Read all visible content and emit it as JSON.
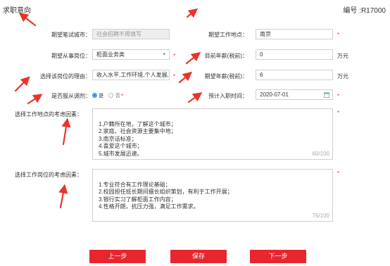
{
  "header": {
    "title": "求职意向",
    "serial_label": "编号 :R17000"
  },
  "form": {
    "interview_city": {
      "label": "期望笔试城市：",
      "placeholder": "社会招聘不用填写",
      "value": ""
    },
    "work_location": {
      "label": "期望工作地点：",
      "value": "南京"
    },
    "position": {
      "label": "期望从事岗位：",
      "value": "柜面业务类",
      "dropdown_icon": "chevron-down-icon"
    },
    "min_salary": {
      "label": "目前年薪(税前)：",
      "value": "0",
      "unit": "万元"
    },
    "position_reason": {
      "label": "选择该岗位的理由：",
      "value": "收入水平,工作环境,个人发展,"
    },
    "expected_salary": {
      "label": "期望年薪(税前)：",
      "value": "6",
      "unit": "万元"
    },
    "accept_adjust": {
      "label": "是否服从调剂：",
      "options": [
        "是",
        "否"
      ],
      "selected": "是"
    },
    "start_date": {
      "label": "预计入职时间：",
      "value": "2020-07-01",
      "icon": "calendar-icon"
    },
    "location_factors": {
      "label": "选择工作地点的考虑因素：",
      "value": "1.户籍所在地，了解这个城市；\n2.家庭、社会资源主要集中地；\n3.南京话标准；\n4.喜爱这个城市；\n5.城市发展迅速。",
      "counter": "60/100"
    },
    "position_factors": {
      "label": "选择工作岗位的考虑因素：",
      "value": "1.专业符合有工作理论基础；\n2.校园担任班长期间擅长组织策划，有利于工作开展；\n3.银行实习了解柜面工作内容；\n4.性格开朗，抗压力强，满足工作需求。",
      "counter": "76/100"
    },
    "required_mark": "*"
  },
  "buttons": {
    "prev": "上一步",
    "save": "保存",
    "next": "下一步"
  },
  "colors": {
    "accent_red": "#e8262d",
    "arrow_red": "#e8362a",
    "radio_blue": "#1e88e5"
  }
}
